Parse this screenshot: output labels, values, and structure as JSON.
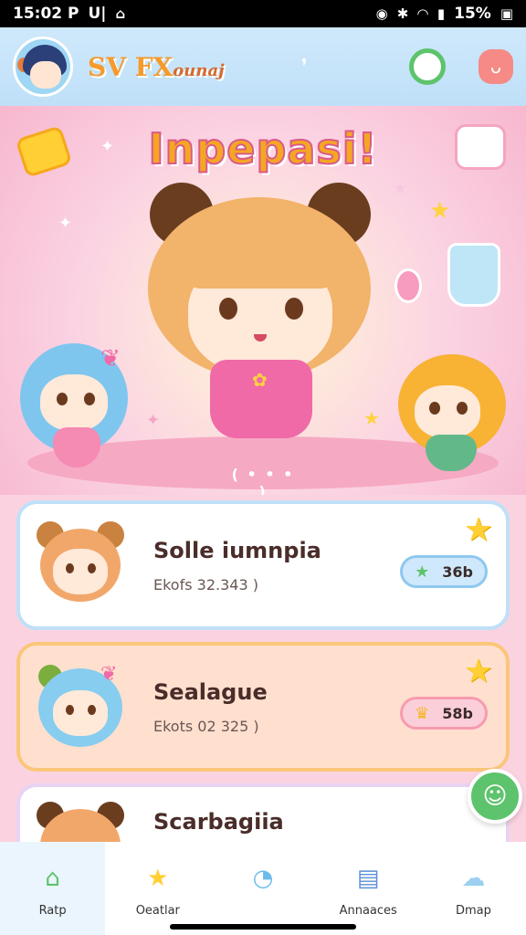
{
  "status_bar": {
    "time": "15:02 P",
    "carrier": "U|",
    "battery": "15%"
  },
  "header": {
    "brand_main": "SV FX",
    "brand_sub": "ounaj"
  },
  "hero": {
    "title": "Inpepasi!",
    "pager": "( • • • )"
  },
  "cards": [
    {
      "title": "Solle iumnpia",
      "subtitle": "Ekofs 32.343 )",
      "badge": "36b"
    },
    {
      "title": "Sealague",
      "subtitle": "Ekots 02 325 )",
      "badge": "58b"
    },
    {
      "title": "Scarbagiia",
      "subtitle": "",
      "badge": ""
    }
  ],
  "bottom_nav": [
    {
      "label": "Ratp",
      "icon": "house-icon"
    },
    {
      "label": "Oeatlar",
      "icon": "star-icon"
    },
    {
      "label": "",
      "icon": "chat-icon"
    },
    {
      "label": "Annaaces",
      "icon": "card-icon"
    },
    {
      "label": "Dmap",
      "icon": "cloud-icon"
    }
  ],
  "colors": {
    "accent_green": "#5dc36c",
    "header_blue": "#cfe8fb",
    "hero_pink": "#fbd3e0",
    "title_orange": "#f5a623"
  }
}
